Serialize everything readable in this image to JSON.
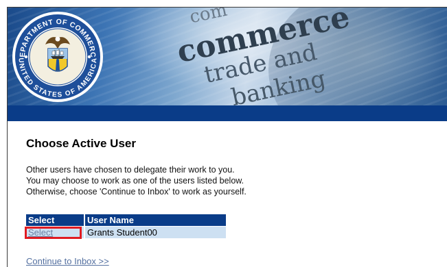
{
  "banner": {
    "seal_top_text": "DEPARTMENT OF COMMERCE",
    "seal_bottom_text": "UNITED STATES OF AMERICA",
    "words": {
      "top": "com",
      "commerce": "commerce",
      "trade": "trade and",
      "bank": "banking"
    }
  },
  "page": {
    "title": "Choose Active User",
    "description_lines": [
      "Other users have chosen to delegate their work to you.",
      "You may choose to work as one of the users listed below.",
      "Otherwise, choose 'Continue to Inbox' to work as yourself."
    ]
  },
  "table": {
    "headers": [
      "Select",
      "User Name"
    ],
    "rows": [
      {
        "select_label": "Select",
        "user_name": "Grants Student00"
      }
    ]
  },
  "continue_link": "Continue to Inbox >>",
  "colors": {
    "nav_bar": "#0a3c88",
    "table_header": "#0a3c88",
    "table_row": "#cde0f2",
    "highlight": "#e01b22",
    "link": "#5470a0"
  }
}
